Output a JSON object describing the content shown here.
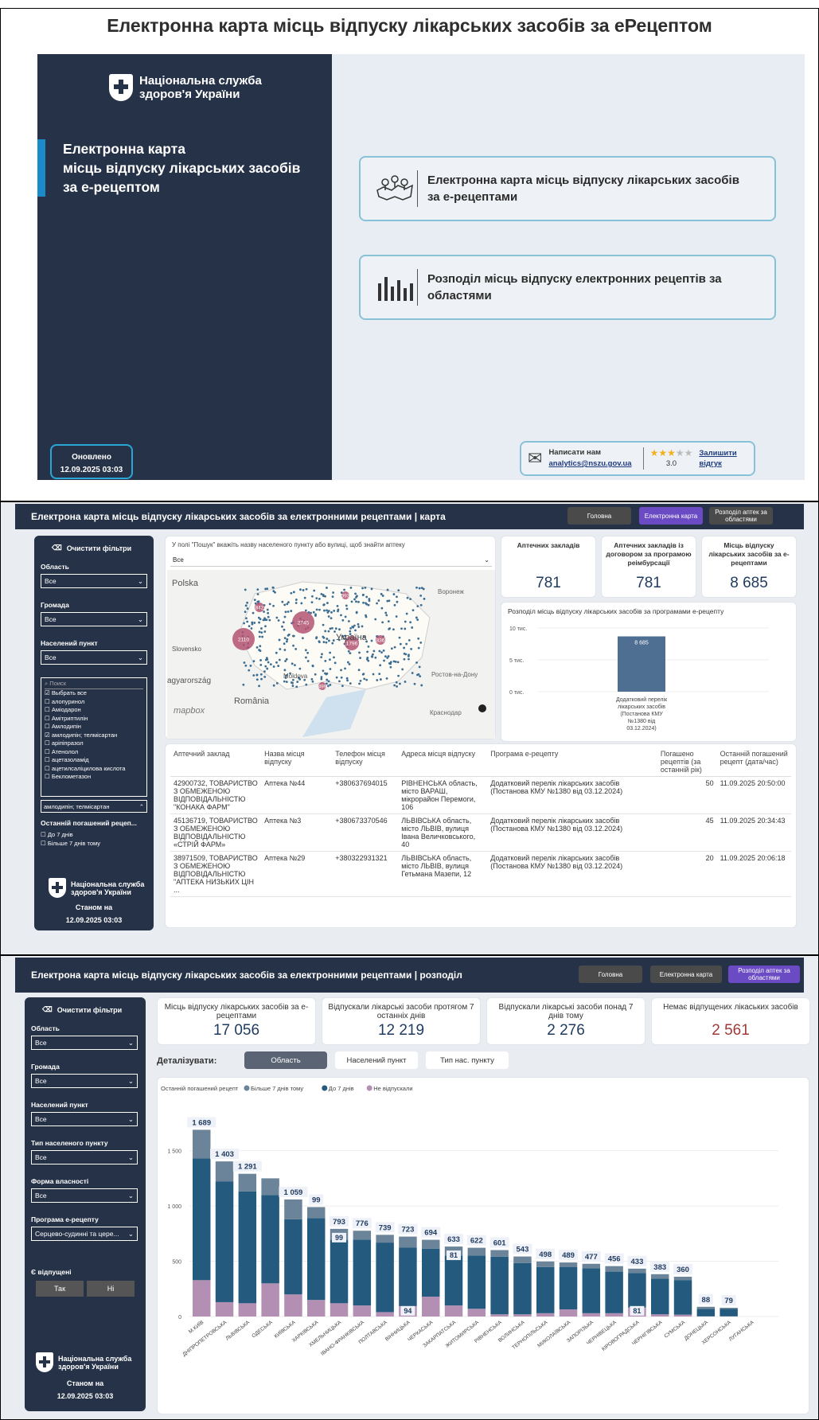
{
  "panel1": {
    "title": "Електронна карта місць відпуску лікарських засобів за еРецептом",
    "brand": "Національна служба\nздоров'я України",
    "heading": "Електронна карта\nмісць відпуску лікарських засобів\nза е-рецептом",
    "nav1": "Електронна карта місць відпуску лікарських засобів\nза е-рецептами",
    "nav2": "Розподіл місць відпуску електронних рецептів за\nобластями",
    "updated_label": "Оновлено",
    "updated_value": "12.09.2025 03:03",
    "contact_label": "Написати нам",
    "contact_email": "analytics@nszu.gov.ua",
    "rating": "3.0",
    "feedback": "Залишити\nвідгук"
  },
  "panel2": {
    "title": "Електрона карта місць відпуску лікарських засобів за електронними рецептами | карта",
    "btn_home": "Головна",
    "btn_map": "Електронна карта",
    "btn_dist": "Розподіл аптек за\nобластями",
    "clear": "Очистити фільтри",
    "filters": [
      {
        "label": "Область",
        "value": "Все"
      },
      {
        "label": "Громада",
        "value": "Все"
      },
      {
        "label": "Населений пункт",
        "value": "Все"
      }
    ],
    "search_ph": "Поиск",
    "drugs": [
      "Выбрать все",
      "алопуринол",
      "Аміодарон",
      "Амітриптилін",
      "Амлодипін",
      "амлодипін; телмісартан",
      "аріпіпразол",
      "Атенолол",
      "ацетазоламід",
      "ацетилсаліцилова кислота",
      "Беклометазон"
    ],
    "drug_selected": "амлодипін; телмісартан",
    "last_label": "Останній погашений рецеп...",
    "last_opts": [
      "До 7 днів",
      "Більше 7 днів тому"
    ],
    "brand": "Національна служба\nздоров'я України",
    "asof": "Станом на",
    "asof_date": "12.09.2025 03:03",
    "search_hint": "У полі \"Пошук\" вкажіть назву населеного пункту або вулиці, щоб знайти аптеку",
    "search_value": "Все",
    "map_labels": {
      "pl": "Polska",
      "sk": "Slovensko",
      "hu": "agyarország",
      "ro": "România",
      "md": "Moldova",
      "ua": "Україна",
      "vor": "Воронеж",
      "ros": "Ростов-на-Дону",
      "kr": "Краснодар",
      "mb": "mapbox"
    },
    "clusters": [
      "2110",
      "2745",
      "842",
      "1796",
      "393",
      "836",
      "499"
    ],
    "kpis": [
      {
        "t": "Аптечних закладів",
        "v": "781"
      },
      {
        "t": "Аптечних закладів із договором за програмою реімбурсації",
        "v": "781"
      },
      {
        "t": "Місць відпуску лікарських засобів за е-рецептами",
        "v": "8 685"
      }
    ],
    "chart_title": "Розподіл місць відпуску лікарських засобів за програмами е-рецепту",
    "chart_data": {
      "type": "bar",
      "categories": [
        "Додатковий перелік лікарських засобів (Постанова КМУ №1380 від 03.12.2024)"
      ],
      "values": [
        8685
      ],
      "yticks": [
        "10 тис.",
        "5 тис.",
        "0 тис."
      ],
      "ylim": [
        0,
        10000
      ],
      "data_label": "8 685"
    },
    "table": {
      "headers": [
        "Аптечний заклад",
        "Назва місця відпуску",
        "Телефон місця відпуску",
        "Адреса місця відпуску",
        "Програма е-рецепту",
        "Погашено рецептів (за останній рік)",
        "Останній погашений рецепт (дата/час)"
      ],
      "rows": [
        [
          "42900732, ТОВАРИСТВО З ОБМЕЖЕНОЮ ВІДПОВІДАЛЬНІСТЮ \"КОНАКА ФАРМ\"",
          "Аптека №44",
          "+380637694015",
          "РІВНЕНСЬКА область, місто ВАРАШ, мікрорайон Перемоги, 106",
          "Додатковий перелік лікарських засобів (Постанова КМУ №1380 від 03.12.2024)",
          "50",
          "11.09.2025 20:50:00"
        ],
        [
          "45136719, ТОВАРИСТВО З ОБМЕЖЕНОЮ ВІДПОВІДАЛЬНІСТЮ «СТРІЙ ФАРМ»",
          "Аптека №3",
          "+380673370546",
          "ЛЬВІВСЬКА область, місто ЛЬВІВ, вулиця Івана Величковського, 40",
          "Додатковий перелік лікарських засобів (Постанова КМУ №1380 від 03.12.2024)",
          "45",
          "11.09.2025 20:34:43"
        ],
        [
          "38971509, ТОВАРИСТВО З ОБМЕЖЕНОЮ ВІДПОВІДАЛЬНІСТЮ \"АПТЕКА НИЗЬКИХ ЦІН ...",
          "Аптека №29",
          "+380322931321",
          "ЛЬВІВСЬКА область, місто ЛЬВІВ, вулиця Гетьмана Мазепи, 12",
          "Додатковий перелік лікарських засобів (Постанова КМУ №1380 від 03.12.2024)",
          "20",
          "11.09.2025 20:06:18"
        ]
      ]
    }
  },
  "panel3": {
    "title": "Електрона карта місць відпуску лікарських засобів за електронними рецептами | розподіл",
    "btn_home": "Головна",
    "btn_map": "Електронна карта",
    "btn_dist": "Розподіл аптек за\nобластями",
    "clear": "Очистити фільтри",
    "filters": [
      {
        "label": "Область",
        "value": "Все"
      },
      {
        "label": "Громада",
        "value": "Все"
      },
      {
        "label": "Населений пункт",
        "value": "Все"
      },
      {
        "label": "Тип населеного пункту",
        "value": "Все"
      },
      {
        "label": "Форма власності",
        "value": "Все"
      },
      {
        "label": "Програма е-рецепту",
        "value": "Серцево-судинні та цере..."
      }
    ],
    "dispensed_label": "Є відпущені",
    "yes": "Так",
    "no": "Ні",
    "brand": "Національна служба\nздоров'я України",
    "asof": "Станом на",
    "asof_date": "12.09.2025 03:03",
    "kpis": [
      {
        "t": "Місць відпуску лікарських засобів за е-рецептами",
        "v": "17 056"
      },
      {
        "t": "Відпускали лікарські засоби протягом 7 останніх днів",
        "v": "12 219"
      },
      {
        "t": "Відпускали лікарські засоби понад 7 днів тому",
        "v": "2 276"
      },
      {
        "t": "Немає відпущених лікаських засобів",
        "v": "2 561"
      }
    ],
    "detail_label": "Деталізувати:",
    "tabs": [
      "Область",
      "Населений пункт",
      "Тип нас. пункту"
    ],
    "legend_title": "Останній погашений рецепт",
    "chart_data": {
      "type": "bar",
      "stacked": true,
      "categories": [
        "М.КИЇВ",
        "ДНІПРОПЕТРОВСЬКА",
        "ЛЬВІВСЬКА",
        "ОДЕСЬКА",
        "КИЇВСЬКА",
        "ХАРКІВСЬКА",
        "ХМЕЛЬНИЦЬКА",
        "ІВАНО-ФРАНКІВСЬКА",
        "ПОЛТАВСЬКА",
        "ВІННИЦЬКА",
        "ЧЕРКАСЬКА",
        "ЗАКАРПАТСЬКА",
        "ЖИТОМИРСЬКА",
        "РІВНЕНСЬКА",
        "ВОЛИНСЬКА",
        "ТЕРНОПІЛЬСЬКА",
        "МИКОЛАЇВСЬКА",
        "ЗАПОРІЗЬКА",
        "ЧЕРНІВЕЦЬКА",
        "КІРОВОГРАДСЬКА",
        "ЧЕРНІГІВСЬКА",
        "СУМСЬКА",
        "ДОНЕЦЬКА",
        "ХЕРСОНСЬКА",
        "ЛУГАНСЬКА"
      ],
      "totals": [
        1689,
        1403,
        1291,
        1250,
        1059,
        990,
        793,
        776,
        739,
        723,
        694,
        633,
        622,
        601,
        543,
        498,
        489,
        477,
        456,
        433,
        383,
        360,
        88,
        79,
        0
      ],
      "series": [
        {
          "name": "Більше 7 днів тому",
          "color": "#6b8499",
          "values": [
            260,
            180,
            160,
            150,
            180,
            99,
            99,
            80,
            70,
            100,
            80,
            81,
            70,
            60,
            60,
            50,
            40,
            40,
            50,
            40,
            40,
            30,
            20,
            10,
            0
          ]
        },
        {
          "name": "До 7 днів",
          "color": "#235a7e",
          "values": [
            1100,
            1093,
            1011,
            800,
            679,
            741,
            574,
            596,
            629,
            529,
            434,
            452,
            482,
            521,
            463,
            418,
            384,
            407,
            376,
            312,
            323,
            313,
            66,
            67,
            0
          ]
        },
        {
          "name": "Не відпускали",
          "color": "#b48fb4",
          "values": [
            329,
            130,
            120,
            300,
            200,
            150,
            120,
            100,
            40,
            94,
            180,
            100,
            70,
            20,
            20,
            30,
            65,
            30,
            30,
            81,
            20,
            17,
            2,
            2,
            0
          ]
        }
      ],
      "data_labels": [
        {
          "i": 0,
          "t": "1 689"
        },
        {
          "i": 1,
          "t": "1 403"
        },
        {
          "i": 2,
          "t": "1 291"
        },
        {
          "i": 4,
          "t": "1 059"
        },
        {
          "i": 5,
          "t": "99"
        },
        {
          "i": 6,
          "t": "793"
        },
        {
          "i": 7,
          "t": "776"
        },
        {
          "i": 8,
          "t": "739"
        },
        {
          "i": 9,
          "t": "723"
        },
        {
          "i": 10,
          "t": "694"
        },
        {
          "i": 11,
          "t": "633"
        },
        {
          "i": 12,
          "t": "622"
        },
        {
          "i": 13,
          "t": "601"
        },
        {
          "i": 14,
          "t": "543"
        },
        {
          "i": 15,
          "t": "498"
        },
        {
          "i": 16,
          "t": "489"
        },
        {
          "i": 17,
          "t": "477"
        },
        {
          "i": 18,
          "t": "456"
        },
        {
          "i": 19,
          "t": "433"
        },
        {
          "i": 20,
          "t": "383"
        },
        {
          "i": 21,
          "t": "360"
        },
        {
          "i": 22,
          "t": "88"
        },
        {
          "i": 23,
          "t": "79"
        }
      ],
      "inner_labels": [
        {
          "i": 6,
          "t": "99"
        },
        {
          "i": 11,
          "t": "81"
        },
        {
          "i": 9,
          "t": "94"
        },
        {
          "i": 19,
          "t": "81"
        }
      ],
      "yticks": [
        "1 500",
        "1 000",
        "500",
        "0"
      ],
      "ylim": [
        0,
        1800
      ]
    }
  }
}
